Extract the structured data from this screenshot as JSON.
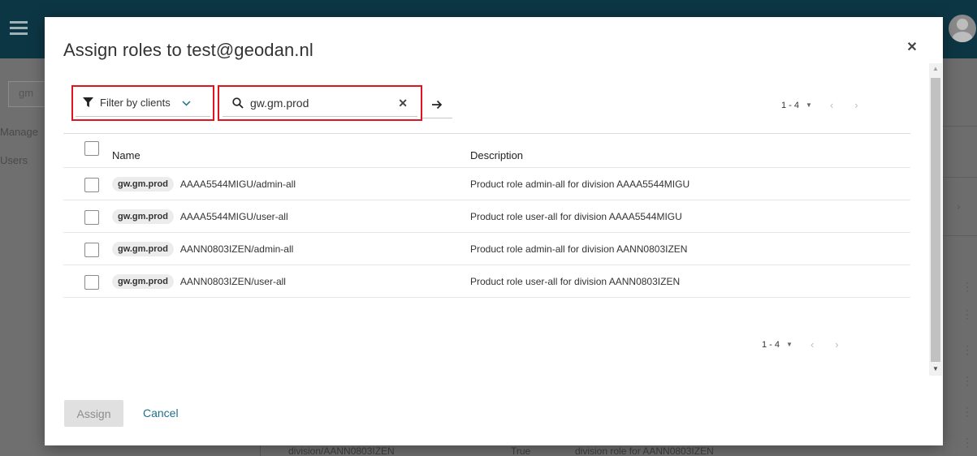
{
  "background": {
    "search_value": "gm",
    "nav_manage": "Manage",
    "nav_users": "Users",
    "bottom_row": {
      "name": "division/AANN0803IZEN",
      "flag": "True",
      "description": "division role for AANN0803IZEN"
    }
  },
  "dialog": {
    "title": "Assign roles to test@geodan.nl",
    "close_icon": "close-icon"
  },
  "toolbar": {
    "filter_label": "Filter by clients",
    "search_value": "gw.gm.prod",
    "search_go_icon": "arrow-right-icon"
  },
  "pager_top": {
    "range": "1 - 4",
    "prev": "‹",
    "next": "›"
  },
  "pager_bottom": {
    "range": "1 - 4",
    "prev": "‹",
    "next": "›"
  },
  "table": {
    "headers": {
      "name": "Name",
      "description": "Description"
    },
    "rows": [
      {
        "client": "gw.gm.prod",
        "role": "AAAA5544MIGU/admin-all",
        "description": "Product role admin-all for division AAAA5544MIGU"
      },
      {
        "client": "gw.gm.prod",
        "role": "AAAA5544MIGU/user-all",
        "description": "Product role user-all for division AAAA5544MIGU"
      },
      {
        "client": "gw.gm.prod",
        "role": "AANN0803IZEN/admin-all",
        "description": "Product role admin-all for division AANN0803IZEN"
      },
      {
        "client": "gw.gm.prod",
        "role": "AANN0803IZEN/user-all",
        "description": "Product role user-all for division AANN0803IZEN"
      }
    ]
  },
  "footer": {
    "assign_label": "Assign",
    "cancel_label": "Cancel"
  },
  "colors": {
    "accent": "#1f6f8b",
    "highlight": "#e0141e",
    "topbar": "#0d3644"
  }
}
